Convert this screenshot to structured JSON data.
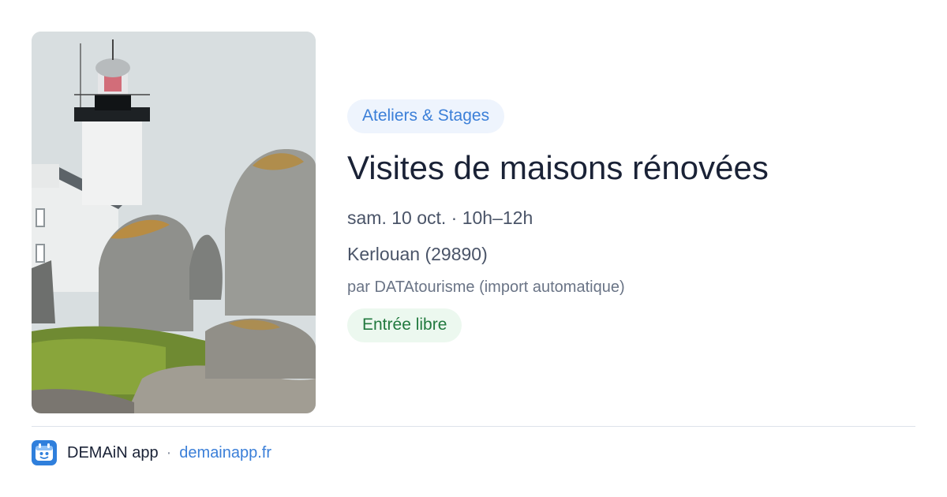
{
  "event": {
    "category": "Ateliers & Stages",
    "title": "Visites de maisons rénovées",
    "date": "sam. 10 oct. · 10h–12h",
    "location": "Kerlouan (29890)",
    "organizer": "par DATAtourisme (import automatique)",
    "price": "Entrée libre",
    "image": "lighthouse-rocks-photo"
  },
  "footer": {
    "app_name": "DEMAiN app",
    "separator": "·",
    "url": "demainapp.fr",
    "logo": "demain-app-logo"
  },
  "colors": {
    "accent": "#3b7fd8",
    "chip_bg": "#eef4fd",
    "price_text": "#21793e",
    "price_bg": "#ecf8ef",
    "title": "#1a2236"
  }
}
